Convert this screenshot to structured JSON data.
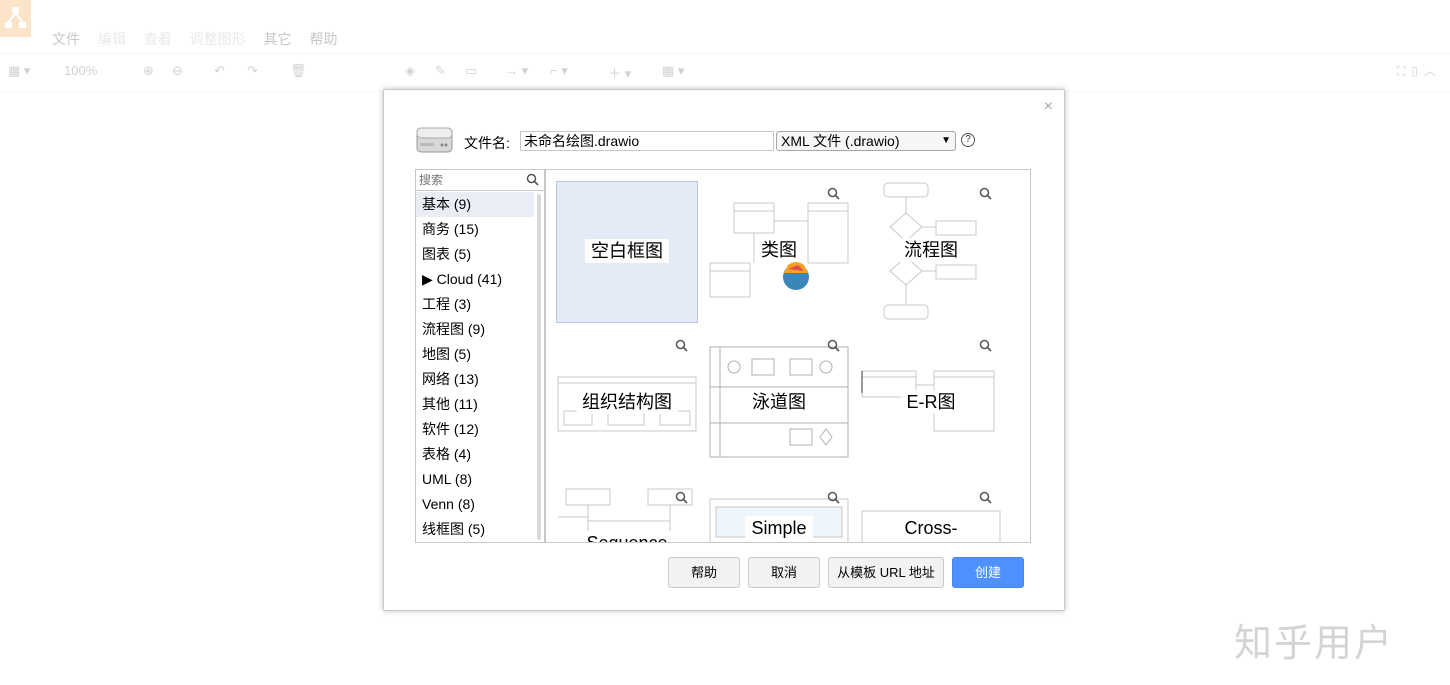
{
  "app": {
    "menu": [
      {
        "label": "文件",
        "dim": false
      },
      {
        "label": "编辑",
        "dim": true
      },
      {
        "label": "查看",
        "dim": true
      },
      {
        "label": "调整图形",
        "dim": true
      },
      {
        "label": "其它",
        "dim": false
      },
      {
        "label": "帮助",
        "dim": false
      }
    ],
    "zoom_level": "100%"
  },
  "dialog": {
    "filename_label": "文件名:",
    "filename_value": "未命名绘图.drawio",
    "format_selected": "XML 文件 (.drawio)",
    "help_glyph": "?",
    "close_glyph": "×",
    "search_placeholder": "搜索",
    "categories": [
      {
        "label": "基本 (9)",
        "selected": true
      },
      {
        "label": "商务 (15)"
      },
      {
        "label": "图表 (5)"
      },
      {
        "label": "▶ Cloud (41)"
      },
      {
        "label": "工程 (3)"
      },
      {
        "label": "流程图 (9)"
      },
      {
        "label": "地图 (5)"
      },
      {
        "label": "网络 (13)"
      },
      {
        "label": "其他 (11)"
      },
      {
        "label": "软件 (12)"
      },
      {
        "label": "表格 (4)"
      },
      {
        "label": "UML (8)"
      },
      {
        "label": "Venn (8)"
      },
      {
        "label": "线框图 (5)"
      }
    ],
    "templates": [
      {
        "label": "空白框图"
      },
      {
        "label": "类图"
      },
      {
        "label": "流程图"
      },
      {
        "label": "组织结构图"
      },
      {
        "label": "泳道图"
      },
      {
        "label": "E-R图"
      },
      {
        "label": "Sequence"
      },
      {
        "label": "Simple"
      },
      {
        "label": "Cross-"
      }
    ],
    "buttons": {
      "help": "帮助",
      "cancel": "取消",
      "from_url": "从模板 URL 地址",
      "create": "创建"
    }
  },
  "watermark": "知乎用户",
  "colors": {
    "accent": "#4d90fe",
    "selected_tile": "#e3ebf6",
    "logo": "#f08705"
  }
}
